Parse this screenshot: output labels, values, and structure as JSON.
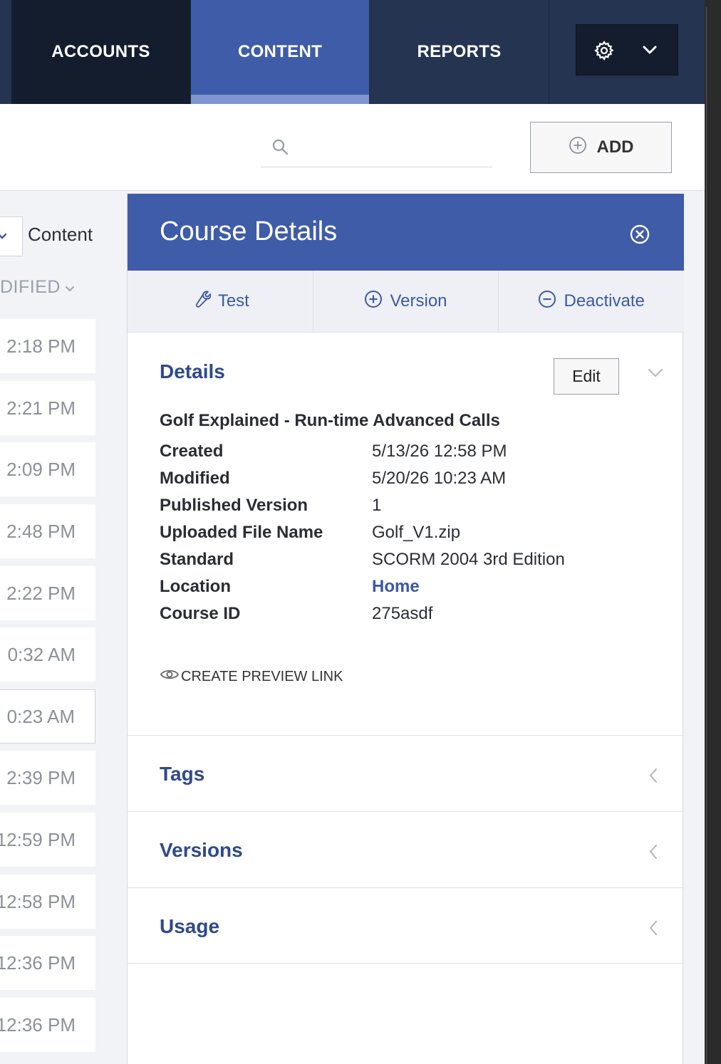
{
  "nav": {
    "tabs": [
      {
        "label": "ACCOUNTS"
      },
      {
        "label": "CONTENT"
      },
      {
        "label": "REPORTS"
      }
    ],
    "active_tab": "CONTENT",
    "settings_icon": "gear-icon",
    "menu_icon": "chevron-down-icon"
  },
  "toolbar": {
    "search_placeholder": "",
    "add_label": "ADD"
  },
  "list": {
    "view_label": "Content",
    "column_header": "DIFIED",
    "rows": [
      "2:18 PM",
      "2:21 PM",
      "2:09 PM",
      "2:48 PM",
      "2:22 PM",
      "0:32 AM",
      "0:23 AM",
      "2:39 PM",
      "12:59 PM",
      "12:58 PM",
      "12:36 PM",
      "12:36 PM"
    ],
    "selected_row_index": 6
  },
  "panel": {
    "title": "Course Details",
    "actions": [
      {
        "label": "Test",
        "icon": "wrench-icon"
      },
      {
        "label": "Version",
        "icon": "plus-circle-icon"
      },
      {
        "label": "Deactivate",
        "icon": "minus-circle-icon"
      }
    ],
    "details": {
      "title": "Details",
      "edit_label": "Edit",
      "course_name": "Golf Explained - Run-time Advanced Calls",
      "fields": [
        {
          "key": "Created",
          "value": "5/13/26 12:58 PM"
        },
        {
          "key": "Modified",
          "value": "5/20/26 10:23 AM"
        },
        {
          "key": "Published Version",
          "value": "1"
        },
        {
          "key": "Uploaded File Name",
          "value": "Golf_V1.zip"
        },
        {
          "key": "Standard",
          "value": "SCORM 2004 3rd Edition"
        },
        {
          "key": "Location",
          "value": "Home"
        },
        {
          "key": "Course ID",
          "value": "275asdf"
        }
      ],
      "preview_link_label": "CREATE PREVIEW LINK"
    },
    "sections": [
      {
        "title": "Tags"
      },
      {
        "title": "Versions"
      },
      {
        "title": "Usage"
      }
    ]
  },
  "colors": {
    "nav_bg": "#243451",
    "nav_dark": "#141d2e",
    "accent": "#3f5ca8",
    "accent_light": "#7e95d2",
    "link": "#3b5aa4"
  }
}
